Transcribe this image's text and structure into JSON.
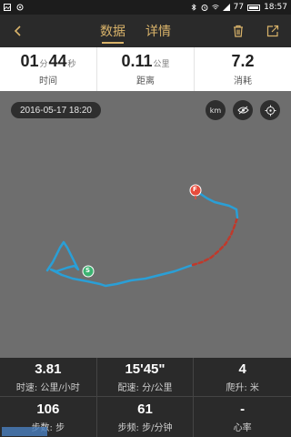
{
  "statusbar": {
    "battery": "77",
    "time": "18:57"
  },
  "nav": {
    "tabs": [
      {
        "label": "数据",
        "active": true
      },
      {
        "label": "详情",
        "active": false
      }
    ],
    "accent_color": "#d9b36a"
  },
  "summary": {
    "duration": {
      "min": "01",
      "min_unit": "分",
      "sec": "44",
      "sec_unit": "秒",
      "label": "时间"
    },
    "distance": {
      "value": "0.11",
      "unit": "公里",
      "label": "距离"
    },
    "calories": {
      "value": "7.2",
      "label": "消耗"
    }
  },
  "map": {
    "date": "2016-05-17 18:20",
    "km_label": "km",
    "start_marker": "S",
    "finish_marker": "F",
    "route_color": "#2a9fd6",
    "dashed_color": "#c0392b"
  },
  "stats": [
    {
      "value": "3.81",
      "label": "时速: 公里/小时"
    },
    {
      "value": "15'45\"",
      "label": "配速: 分/公里"
    },
    {
      "value": "4",
      "label": "爬升: 米"
    },
    {
      "value": "106",
      "label": "步数: 步"
    },
    {
      "value": "61",
      "label": "步频: 步/分钟"
    },
    {
      "value": "-",
      "label": "心率"
    }
  ]
}
